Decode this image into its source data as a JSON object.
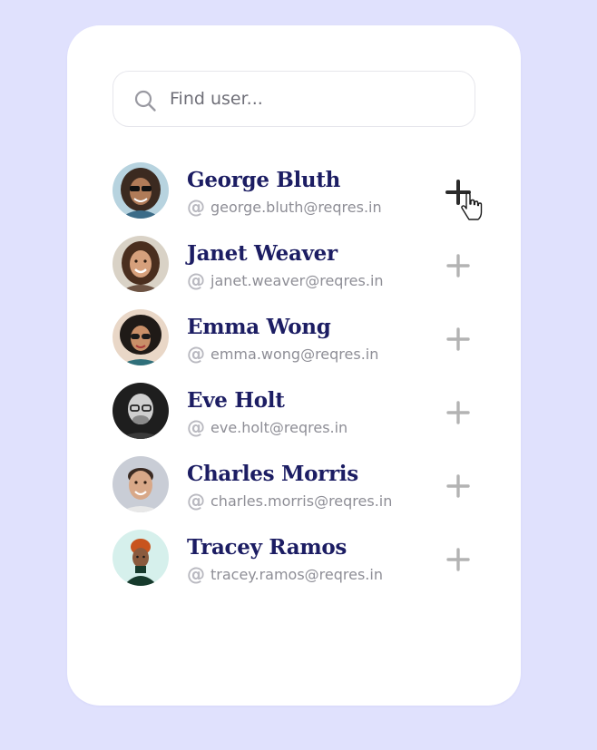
{
  "search": {
    "placeholder": "Find user...",
    "value": ""
  },
  "users": [
    {
      "name": "George Bluth",
      "email": "george.bluth@reqres.in",
      "avatar_icon": "portrait-george-icon",
      "add_state": "hover"
    },
    {
      "name": "Janet Weaver",
      "email": "janet.weaver@reqres.in",
      "avatar_icon": "portrait-janet-icon",
      "add_state": "default"
    },
    {
      "name": "Emma Wong",
      "email": "emma.wong@reqres.in",
      "avatar_icon": "portrait-emma-icon",
      "add_state": "default"
    },
    {
      "name": "Eve Holt",
      "email": "eve.holt@reqres.in",
      "avatar_icon": "portrait-eve-icon",
      "add_state": "default"
    },
    {
      "name": "Charles Morris",
      "email": "charles.morris@reqres.in",
      "avatar_icon": "portrait-charles-icon",
      "add_state": "default"
    },
    {
      "name": "Tracey Ramos",
      "email": "tracey.ramos@reqres.in",
      "avatar_icon": "portrait-tracey-icon",
      "add_state": "default"
    }
  ],
  "icons": {
    "search": "search-icon",
    "email": "at-icon",
    "add": "plus-icon",
    "cursor": "hand-pointer-icon"
  },
  "colors": {
    "background": "#e0e1fd",
    "card": "#ffffff",
    "name_text": "#1c1d63",
    "email_text": "#8e8e96",
    "add_default": "#b3b3b3",
    "add_hover": "#2b2b2b"
  }
}
